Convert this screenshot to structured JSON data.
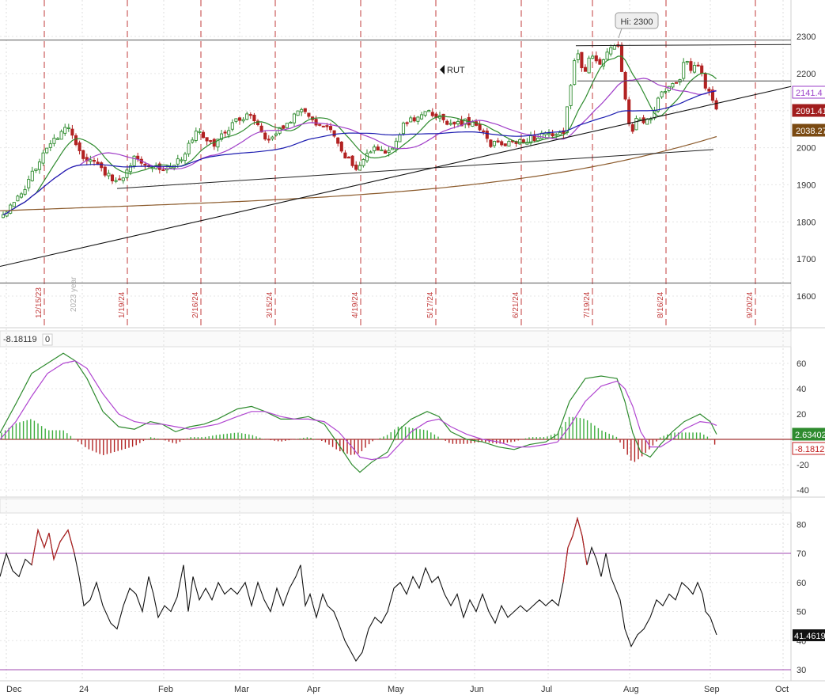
{
  "chart_data": [
    {
      "type": "candlestick",
      "symbol_label": "RUT",
      "annotation_high": "Hi: 2300",
      "ylim": [
        1520,
        2360
      ],
      "y_ticks": [
        1600,
        1700,
        1800,
        1900,
        2000,
        2100,
        2200,
        2300
      ],
      "expiry_dates": [
        "12/15/23",
        "1/19/24",
        "2/16/24",
        "3/15/24",
        "4/19/24",
        "5/17/24",
        "6/21/24",
        "7/19/24",
        "8/16/24",
        "9/20/24"
      ],
      "year_marker": "2023 year",
      "price_badges": [
        {
          "value": "2141.4",
          "color": "#9b3fc8"
        },
        {
          "value": "2091.41",
          "color": "#a11d1d"
        },
        {
          "value": "2038.27",
          "color": "#7a4a12"
        }
      ],
      "horizontal_levels": [
        2290,
        1635,
        2180
      ],
      "colors": {
        "up": "#2e8b2e",
        "down": "#b22222",
        "ma_short": "#2e8b2e",
        "ma_mid": "#a03ec8",
        "ma_long": "#1c1cb0",
        "ma_200": "#8b5a2b",
        "expiry_line": "#c23b3b"
      }
    },
    {
      "type": "line",
      "name_label": "-8.18119",
      "zero_label": "0",
      "ylim": [
        -45,
        72
      ],
      "y_ticks": [
        -40,
        -20,
        20,
        40,
        60
      ],
      "last_values": [
        {
          "value": "2.63402",
          "color": "#2e8b2e"
        },
        {
          "value": "-8.1812",
          "color": "#c21d1d"
        }
      ]
    },
    {
      "type": "line",
      "ylim": [
        27,
        84
      ],
      "y_ticks": [
        30,
        40,
        50,
        60,
        70,
        80
      ],
      "levels": [
        70,
        30
      ],
      "last_value": "41.4619"
    }
  ],
  "x_axis": {
    "labels": [
      "Dec",
      "24",
      "Feb",
      "Mar",
      "Apr",
      "May",
      "Jun",
      "Jul",
      "Aug",
      "Sep",
      "Oct"
    ]
  }
}
